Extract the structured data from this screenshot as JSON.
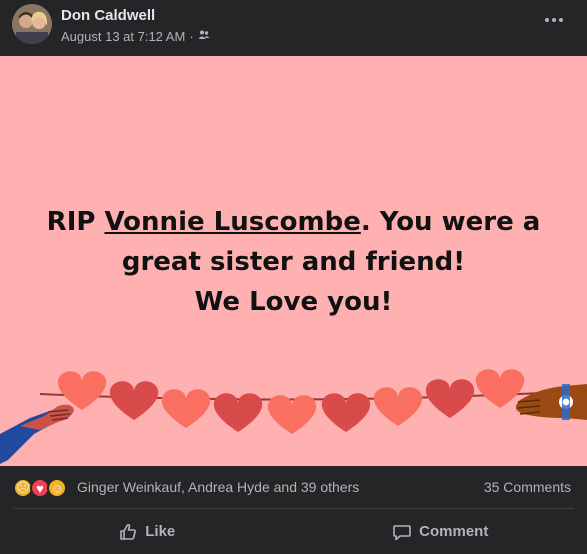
{
  "post": {
    "author": "Don Caldwell",
    "timestamp": "August 13 at 7:12 AM",
    "separator": "·",
    "audience_icon": "friends-icon",
    "more_icon": "more-options-icon"
  },
  "banner": {
    "background": "#ffb0b0",
    "line1_prefix": "RIP ",
    "line1_link": "Vonnie Luscombe",
    "line1_suffix": ". You were a",
    "line2": "great sister and friend!",
    "line3": "We Love you!",
    "heart_colors": [
      "#fb6f60",
      "#d94b4b"
    ],
    "illustration": "heart-garland"
  },
  "reactions": {
    "icons": [
      "sad-reaction-icon",
      "love-reaction-icon",
      "care-reaction-icon"
    ],
    "summary": "Ginger Weinkauf, Andrea Hyde and 39 others",
    "comments": "35 Comments"
  },
  "actions": {
    "like": "Like",
    "comment": "Comment"
  }
}
